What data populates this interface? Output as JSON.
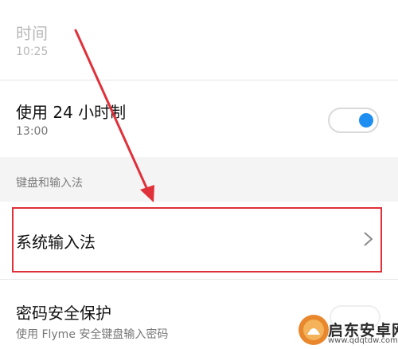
{
  "settings": {
    "time_row": {
      "title": "时间",
      "value": "10:25"
    },
    "hour24_row": {
      "title": "使用 24 小时制",
      "value": "13:00",
      "toggle_on": true
    },
    "section_header": "键盘和输入法",
    "input_method_row": {
      "title": "系统输入法"
    },
    "password_row": {
      "title": "密码安全保护",
      "subtitle": "使用 Flyme 安全键盘输入密码"
    }
  },
  "annotation": {
    "highlight_color": "#e0303a",
    "arrow_color": "#e0303a"
  },
  "watermark": {
    "text": "启东安卓网",
    "url": "www.qdqtdw.com"
  },
  "colors": {
    "toggle_accent": "#1f8ef1",
    "disabled_text": "#b8b8b8"
  }
}
